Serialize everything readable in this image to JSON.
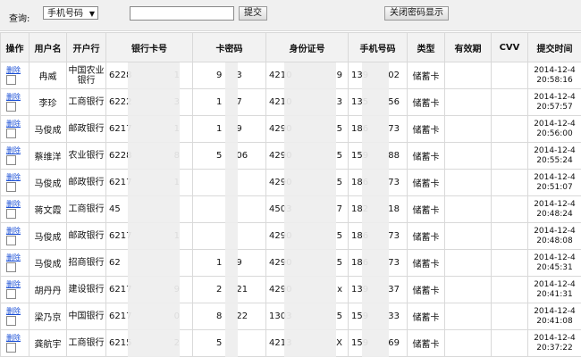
{
  "toolbar": {
    "query_label": "查询:",
    "select_value": "手机号码",
    "search_value": "",
    "submit_label": "提交",
    "close_password_label": "关闭密码显示"
  },
  "table": {
    "headers": [
      "操作",
      "用户名",
      "开户行",
      "银行卡号",
      "卡密码",
      "身份证号",
      "手机号码",
      "类型",
      "有效期",
      "CVV",
      "提交时间"
    ],
    "delete_label": "删除",
    "rows": [
      {
        "name": "冉威",
        "bank": "中国农业银行",
        "card": "6228",
        "card_end": "1",
        "pw": "9",
        "pw_end": "3",
        "id": "4210",
        "id_end": "9",
        "phone": "139",
        "phone_end": "02",
        "type": "储蓄卡",
        "expiry": "",
        "cvv": "",
        "date": "2014-12-4",
        "time": "20:58:16"
      },
      {
        "name": "李珍",
        "bank": "工商银行",
        "card": "6222",
        "card_end": "3",
        "pw": "1",
        "pw_end": "7",
        "id": "4210",
        "id_end": "3",
        "phone": "135",
        "phone_end": "56",
        "type": "储蓄卡",
        "expiry": "",
        "cvv": "",
        "date": "2014-12-4",
        "time": "20:57:57"
      },
      {
        "name": "马俊成",
        "bank": "邮政银行",
        "card": "6217",
        "card_end": "1",
        "pw": "1",
        "pw_end": "9",
        "id": "4290",
        "id_end": "5",
        "phone": "186",
        "phone_end": "73",
        "type": "储蓄卡",
        "expiry": "",
        "cvv": "",
        "date": "2014-12-4",
        "time": "20:56:00"
      },
      {
        "name": "蔡维洋",
        "bank": "农业银行",
        "card": "6228",
        "card_end": "8",
        "pw": "5",
        "pw_end": "06",
        "id": "4290",
        "id_end": "5",
        "phone": "159",
        "phone_end": "88",
        "type": "储蓄卡",
        "expiry": "",
        "cvv": "",
        "date": "2014-12-4",
        "time": "20:55:24"
      },
      {
        "name": "马俊成",
        "bank": "邮政银行",
        "card": "6217",
        "card_end": "1",
        "pw": "",
        "pw_end": "",
        "id": "4290",
        "id_end": "5",
        "phone": "186",
        "phone_end": "73",
        "type": "储蓄卡",
        "expiry": "",
        "cvv": "",
        "date": "2014-12-4",
        "time": "20:51:07"
      },
      {
        "name": "蒋文霞",
        "bank": "工商银行",
        "card": "45",
        "card_end": "",
        "pw": "",
        "pw_end": "",
        "id": "4503",
        "id_end": "7",
        "phone": "182",
        "phone_end": "18",
        "type": "储蓄卡",
        "expiry": "",
        "cvv": "",
        "date": "2014-12-4",
        "time": "20:48:24"
      },
      {
        "name": "马俊成",
        "bank": "邮政银行",
        "card": "6217",
        "card_end": "1",
        "pw": "",
        "pw_end": "",
        "id": "4290",
        "id_end": "5",
        "phone": "186",
        "phone_end": "73",
        "type": "储蓄卡",
        "expiry": "",
        "cvv": "",
        "date": "2014-12-4",
        "time": "20:48:08"
      },
      {
        "name": "马俊成",
        "bank": "招商银行",
        "card": "62",
        "card_end": "",
        "pw": "1",
        "pw_end": "9",
        "id": "4290",
        "id_end": "5",
        "phone": "186",
        "phone_end": "73",
        "type": "储蓄卡",
        "expiry": "",
        "cvv": "",
        "date": "2014-12-4",
        "time": "20:45:31"
      },
      {
        "name": "胡丹丹",
        "bank": "建设银行",
        "card": "6217",
        "card_end": "9",
        "pw": "2",
        "pw_end": "21",
        "id": "4290",
        "id_end": "x",
        "phone": "139",
        "phone_end": "37",
        "type": "储蓄卡",
        "expiry": "",
        "cvv": "",
        "date": "2014-12-4",
        "time": "20:41:31"
      },
      {
        "name": "梁乃京",
        "bank": "中国银行",
        "card": "6217",
        "card_end": "0",
        "pw": "8",
        "pw_end": "22",
        "id": "1303",
        "id_end": "5",
        "phone": "159",
        "phone_end": "33",
        "type": "储蓄卡",
        "expiry": "",
        "cvv": "",
        "date": "2014-12-4",
        "time": "20:41:08"
      },
      {
        "name": "龚航宇",
        "bank": "工商银行",
        "card": "6215",
        "card_end": "2",
        "pw": "5",
        "pw_end": "",
        "id": "4213",
        "id_end": "X",
        "phone": "159",
        "phone_end": "69",
        "type": "储蓄卡",
        "expiry": "",
        "cvv": "",
        "date": "2014-12-4",
        "time": "20:37:22"
      }
    ]
  }
}
